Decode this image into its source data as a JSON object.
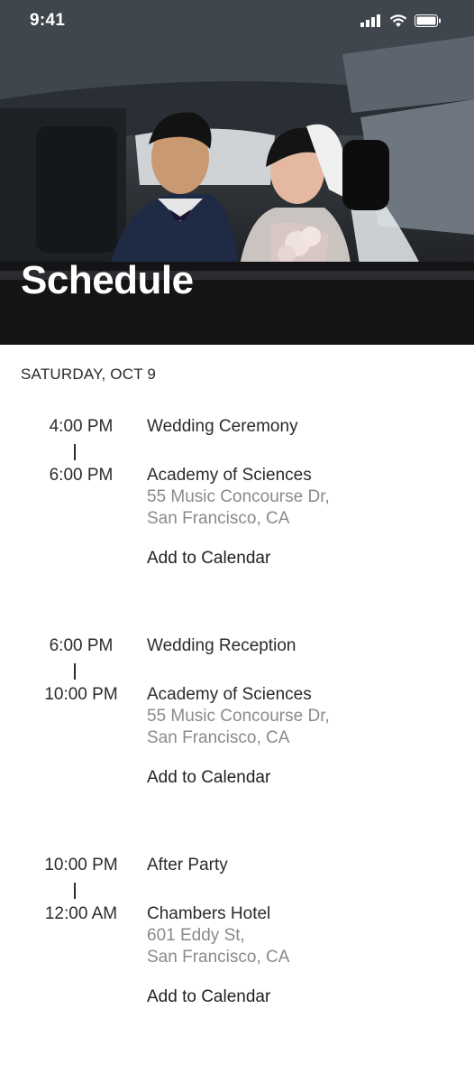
{
  "status_bar": {
    "time": "9:41",
    "icons": [
      "signal-icon",
      "wifi-icon",
      "battery-icon"
    ]
  },
  "header": {
    "title": "Schedule"
  },
  "schedule": {
    "date_heading": "SATURDAY, OCT 9",
    "events": [
      {
        "start": "4:00 PM",
        "end": "6:00 PM",
        "title": "Wedding Ceremony",
        "venue": "Academy of Sciences",
        "address_line1": "55 Music Concourse Dr,",
        "address_line2": "San Francisco, CA",
        "action": "Add to Calendar"
      },
      {
        "start": "6:00 PM",
        "end": "10:00 PM",
        "title": "Wedding Reception",
        "venue": "Academy of Sciences",
        "address_line1": "55 Music Concourse Dr,",
        "address_line2": "San Francisco, CA",
        "action": "Add to Calendar"
      },
      {
        "start": "10:00 PM",
        "end": "12:00 AM",
        "title": "After Party",
        "venue": "Chambers Hotel",
        "address_line1": "601 Eddy St,",
        "address_line2": "San Francisco, CA",
        "action": "Add to Calendar"
      }
    ]
  },
  "colors": {
    "text_primary": "#2b2b2b",
    "text_secondary": "#8a8a8a",
    "background": "#ffffff"
  }
}
